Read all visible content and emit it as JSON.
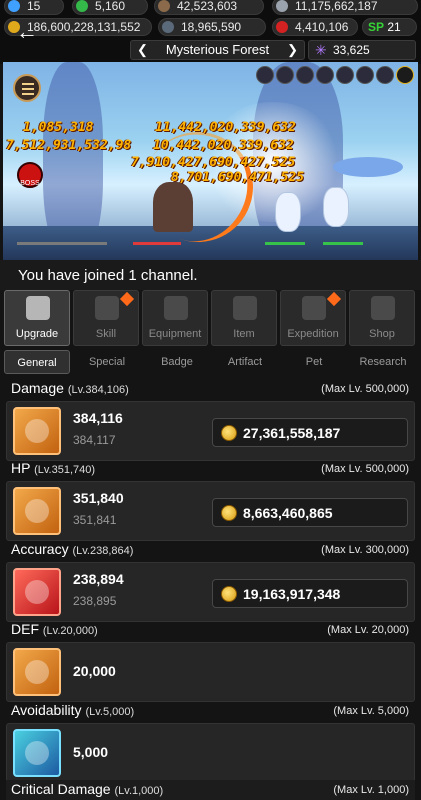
{
  "resources": {
    "r1": "15",
    "r2": "5,160",
    "r3": "42,523,603",
    "r4": "11,175,662,187",
    "gold": "186,600,228,131,552",
    "r6": "18,965,590",
    "r7": "4,410,106",
    "sp_label": "SP",
    "sp_value": "21",
    "tokens": "33,625"
  },
  "stage": {
    "name": "Mysterious Forest",
    "prev": "❮",
    "next": "❯"
  },
  "battle": {
    "damage_numbers": [
      "1,085,318",
      "11,442,020,339,632",
      "7,512,931,532,98",
      "10,442,020,339,632",
      "7,910,427,690,427,525",
      "8,701,690,471,525"
    ],
    "boss_label": "BOSS"
  },
  "channel_message": "You have joined 1 channel.",
  "main_tabs": [
    {
      "label": "Upgrade"
    },
    {
      "label": "Skill"
    },
    {
      "label": "Equipment"
    },
    {
      "label": "Item"
    },
    {
      "label": "Expedition"
    },
    {
      "label": "Shop"
    }
  ],
  "sub_tabs": [
    {
      "label": "General"
    },
    {
      "label": "Special"
    },
    {
      "label": "Badge"
    },
    {
      "label": "Artifact"
    },
    {
      "label": "Pet"
    },
    {
      "label": "Research"
    }
  ],
  "upgrades": [
    {
      "name": "Damage",
      "level": "(Lv.384,106)",
      "max": "(Max Lv. 500,000)",
      "current": "384,116",
      "next": "384,117",
      "cost": "27,361,558,187"
    },
    {
      "name": "HP",
      "level": "(Lv.351,740)",
      "max": "(Max Lv. 500,000)",
      "current": "351,840",
      "next": "351,841",
      "cost": "8,663,460,865"
    },
    {
      "name": "Accuracy",
      "level": "(Lv.238,864)",
      "max": "(Max Lv. 300,000)",
      "current": "238,894",
      "next": "238,895",
      "cost": "19,163,917,348"
    },
    {
      "name": "DEF",
      "level": "(Lv.20,000)",
      "max": "(Max Lv. 20,000)",
      "current": "20,000"
    },
    {
      "name": "Avoidability",
      "level": "(Lv.5,000)",
      "max": "(Max Lv. 5,000)",
      "current": "5,000"
    },
    {
      "name": "Critical Damage",
      "level": "(Lv.1,000)",
      "max": "(Max Lv. 1,000)"
    }
  ],
  "colors": {
    "accent_orange": "#ff6a1a",
    "sp_green": "#37d437",
    "coin": "#d79b10"
  }
}
